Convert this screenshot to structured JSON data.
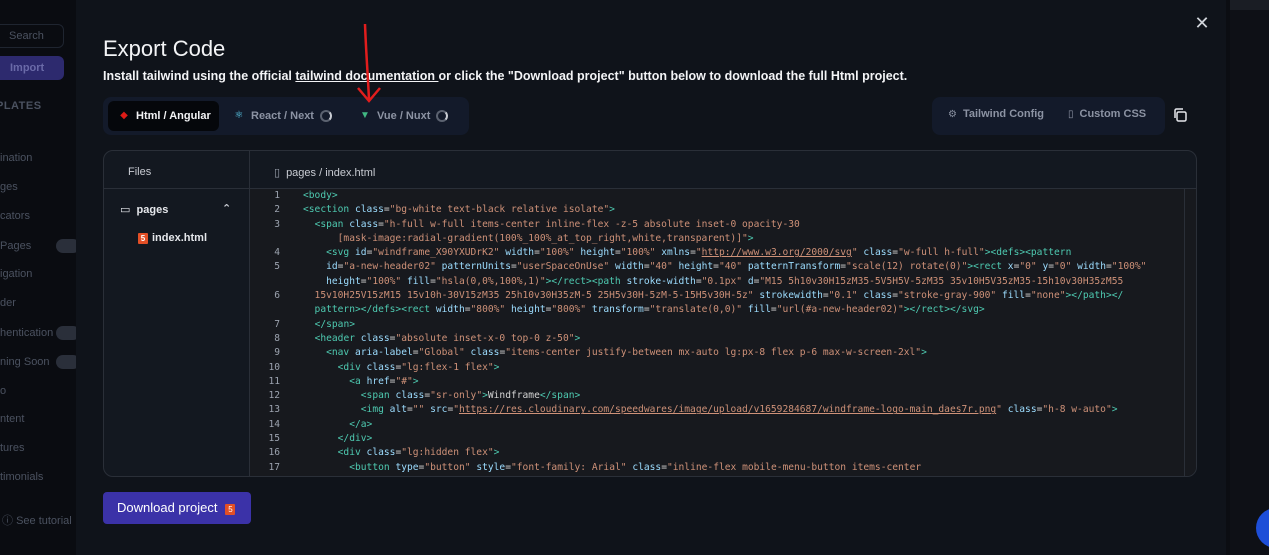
{
  "background": {
    "search_label": "Search",
    "import_label": "Import",
    "section_heading": "PLATES",
    "nav_items": [
      "ination",
      "ges",
      "cators",
      "Pages",
      "igation",
      "der",
      "hentication",
      "ning Soon",
      "o",
      "ntent",
      "tures",
      "timonials"
    ],
    "tutorial_label": "See tutorial"
  },
  "modal": {
    "title": "Export Code",
    "subtitle_before": "Install tailwind using the official ",
    "subtitle_link": "tailwind documentation ",
    "subtitle_after": "or click the \"Download project\" button below to download the full Html project.",
    "frameworks": [
      {
        "label": "Html / Angular",
        "active": true
      },
      {
        "label": "React / Next",
        "active": false
      },
      {
        "label": "Vue / Nuxt",
        "active": false
      }
    ],
    "config": {
      "tailwind_label": "Tailwind Config",
      "css_label": "Custom CSS"
    },
    "editor": {
      "files_label": "Files",
      "path": "pages / index.html",
      "folder": "pages",
      "file": "index.html"
    },
    "download_label": "Download project",
    "colors": {
      "accent": "#3b32a8",
      "active_tab": "#05070b",
      "panel": "#131a2a"
    }
  },
  "code": {
    "line_numbers": [
      "1",
      "2",
      "3",
      "",
      "4",
      "5",
      "",
      "6",
      "",
      "7",
      "8",
      "9",
      "10",
      "11",
      "12",
      "13",
      "14",
      "15",
      "16",
      "17"
    ]
  }
}
